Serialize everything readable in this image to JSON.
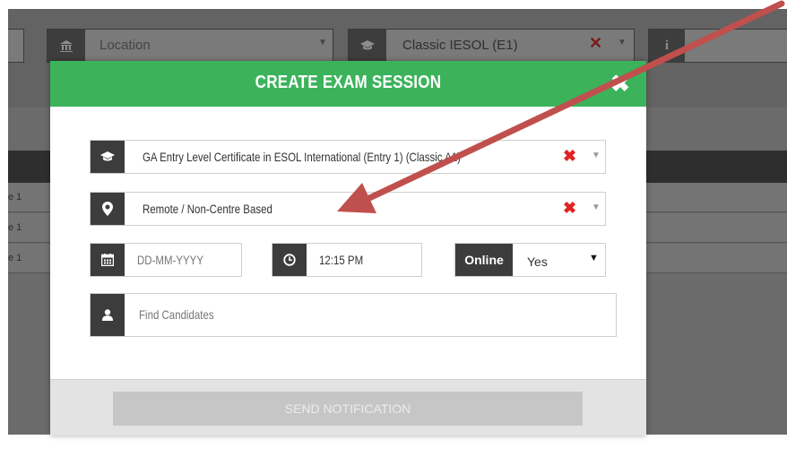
{
  "background": {
    "location_placeholder": "Location",
    "exam_type_value": "Classic IESOL (E1)",
    "info_icon_glyph": "i",
    "row_labels": [
      "e 1",
      "e 1",
      "e 1"
    ]
  },
  "modal": {
    "title": "CREATE EXAM SESSION",
    "close_glyph": "✖",
    "qualification": "GA Entry Level Certificate in ESOL International (Entry 1) (Classic A1)",
    "location": "Remote / Non-Centre Based",
    "date_placeholder": "DD-MM-YYYY",
    "time_value": "12:15 PM",
    "online_label": "Online",
    "online_value": "Yes",
    "candidates_placeholder": "Find Candidates",
    "clear_glyph": "✖",
    "send_button": "SEND NOTIFICATION"
  },
  "icons": {
    "qualification": "graduation-cap-icon",
    "location": "map-marker-icon",
    "date": "calendar-icon",
    "time": "clock-icon",
    "candidates": "user-icon"
  },
  "colors": {
    "header_green": "#3cb35b",
    "clear_red": "#e02424",
    "annotation_arrow": "#c0504d"
  }
}
